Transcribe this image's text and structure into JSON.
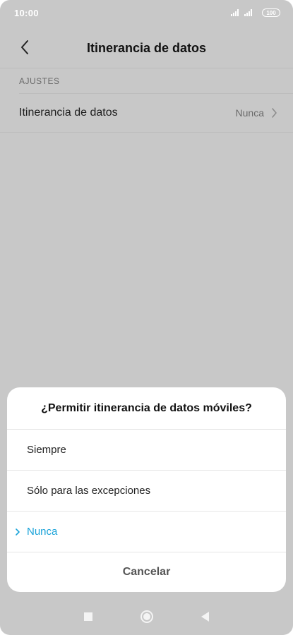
{
  "status_bar": {
    "time": "10:00",
    "battery": "100"
  },
  "header": {
    "title": "Itinerancia de datos",
    "back_icon": "chevron-left-icon"
  },
  "settings": {
    "section_label": "AJUSTES",
    "row": {
      "label": "Itinerancia de datos",
      "value": "Nunca"
    }
  },
  "dialog": {
    "title": "¿Permitir itinerancia de datos móviles?",
    "options": [
      {
        "label": "Siempre",
        "selected": false
      },
      {
        "label": "Sólo para las excepciones",
        "selected": false
      },
      {
        "label": "Nunca",
        "selected": true
      }
    ],
    "cancel_label": "Cancelar"
  },
  "colors": {
    "accent": "#1aa3d9",
    "scrim": "#c8c8c8"
  },
  "nav_bar": {
    "icons": [
      "recents-square-icon",
      "home-circle-icon",
      "back-triangle-icon"
    ]
  }
}
